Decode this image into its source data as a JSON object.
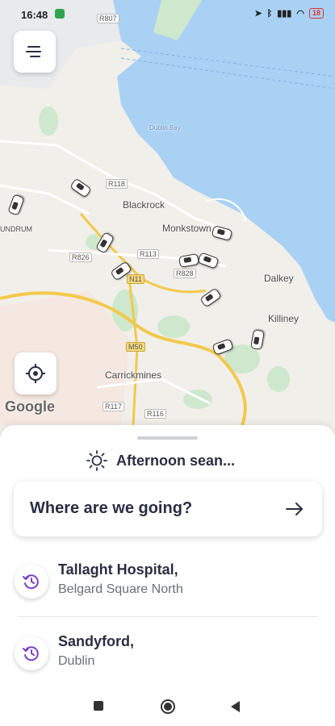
{
  "status_bar": {
    "time": "16:48",
    "battery": "18"
  },
  "map": {
    "places": [
      "Blackrock",
      "Monkstown",
      "Dalkey",
      "Killiney",
      "Carrickmines",
      "UNDRUM",
      "Dublin Bay"
    ],
    "roads": [
      "R807",
      "R118",
      "R826",
      "R113",
      "R828",
      "N11",
      "M50",
      "R117",
      "R116"
    ],
    "attribution": "Google",
    "colors": {
      "sea": "#a9d1f4",
      "land": "#f1efe9",
      "park": "#cde8cc",
      "major_road": "#f2c94c"
    }
  },
  "sheet": {
    "greeting": "Afternoon sean...",
    "search_prompt": "Where are we going?",
    "recents": [
      {
        "title": "Tallaght Hospital,",
        "subtitle": "Belgard Square North"
      },
      {
        "title": "Sandyford,",
        "subtitle": "Dublin"
      }
    ]
  },
  "icons": {
    "menu": "menu-icon",
    "locate": "locate-icon",
    "sun": "sun-icon",
    "arrow": "arrow-right-icon",
    "history": "history-icon"
  },
  "accent_color": "#7b3fc4"
}
